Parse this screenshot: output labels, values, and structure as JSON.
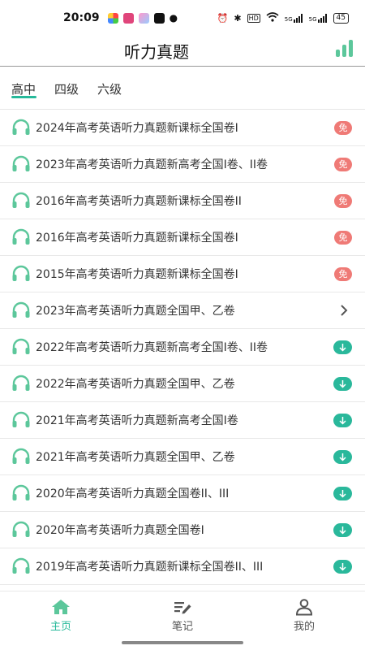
{
  "status_bar": {
    "time": "20:09",
    "signal1": "5G",
    "signal2": "5G",
    "hd": "HD",
    "battery": "45"
  },
  "header": {
    "title": "听力真题"
  },
  "tabs": [
    {
      "label": "高中",
      "active": true
    },
    {
      "label": "四级",
      "active": false
    },
    {
      "label": "六级",
      "active": false
    }
  ],
  "list": [
    {
      "label": "2024年高考英语听力真题新课标全国卷I",
      "status": "免"
    },
    {
      "label": "2023年高考英语听力真题新高考全国I卷、II卷",
      "status": "免"
    },
    {
      "label": "2016年高考英语听力真题新课标全国卷II",
      "status": "免"
    },
    {
      "label": "2016年高考英语听力真题新课标全国卷I",
      "status": "免"
    },
    {
      "label": "2015年高考英语听力真题新课标全国卷I",
      "status": "免"
    },
    {
      "label": "2023年高考英语听力真题全国甲、乙卷",
      "status": "open"
    },
    {
      "label": "2022年高考英语听力真题新高考全国I卷、II卷",
      "status": "download"
    },
    {
      "label": "2022年高考英语听力真题全国甲、乙卷",
      "status": "download"
    },
    {
      "label": "2021年高考英语听力真题新高考全国I卷",
      "status": "download"
    },
    {
      "label": "2021年高考英语听力真题全国甲、乙卷",
      "status": "download"
    },
    {
      "label": "2020年高考英语听力真题全国卷II、III",
      "status": "download"
    },
    {
      "label": "2020年高考英语听力真题全国卷I",
      "status": "download"
    },
    {
      "label": "2019年高考英语听力真题新课标全国卷II、III",
      "status": "download"
    }
  ],
  "bottom_nav": [
    {
      "label": "主页",
      "icon": "home-icon",
      "active": true
    },
    {
      "label": "笔记",
      "icon": "note-icon",
      "active": false
    },
    {
      "label": "我的",
      "icon": "profile-icon",
      "active": false
    }
  ],
  "colors": {
    "accent": "#26b99a",
    "free_badge": "#ef7a76",
    "headphone": "#5cc79b"
  }
}
